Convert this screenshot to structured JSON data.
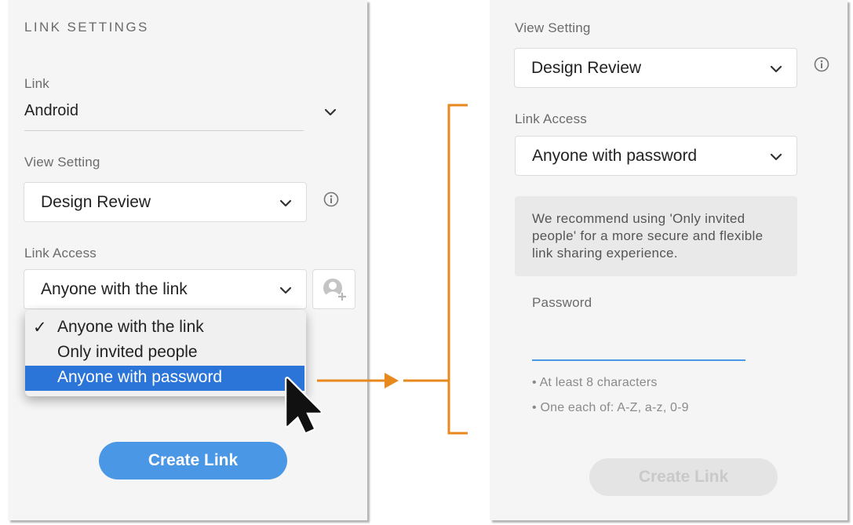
{
  "left_panel": {
    "title": "LINK SETTINGS",
    "link_label": "Link",
    "link_value": "Android",
    "view_setting_label": "View Setting",
    "view_setting_value": "Design Review",
    "link_access_label": "Link Access",
    "link_access_value": "Anyone with the link",
    "dropdown_options": [
      {
        "label": "Anyone with the link",
        "checked": true
      },
      {
        "label": "Only invited people",
        "checked": false
      },
      {
        "label": "Anyone with password",
        "checked": false,
        "highlighted": true
      }
    ],
    "check_mark": "✓",
    "create_link_label": "Create Link"
  },
  "right_panel": {
    "view_setting_label": "View Setting",
    "view_setting_value": "Design Review",
    "link_access_label": "Link Access",
    "link_access_value": "Anyone with password",
    "recommendation": "We recommend using 'Only invited people' for a more secure and flexible link sharing experience.",
    "password_label": "Password",
    "password_value": "",
    "rules": [
      "• At least 8 characters",
      "• One each of: A-Z, a-z, 0-9"
    ],
    "create_link_label": "Create Link",
    "create_link_enabled": false
  },
  "icons": {
    "chevron": "chevron-down-icon",
    "info": "info-icon",
    "add_user": "add-user-icon",
    "cursor": "mouse-pointer-icon"
  },
  "colors": {
    "accent": "#4a97e6",
    "menu_highlight": "#2b74d8",
    "annotation": "#e8891e",
    "password_underline": "#4a97e6",
    "panel_bg": "#f5f5f5"
  }
}
